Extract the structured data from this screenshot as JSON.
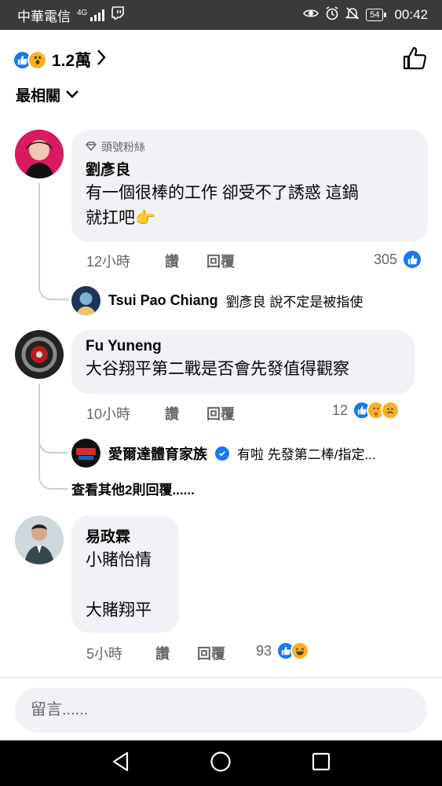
{
  "status_bar": {
    "carrier": "中華電信",
    "network": "4G",
    "battery": "54",
    "time": "00:42"
  },
  "reactions": {
    "total": "1.2萬",
    "types": [
      "like-icon",
      "wow-icon"
    ]
  },
  "sort": {
    "label": "最相關"
  },
  "comments": [
    {
      "badge": "頭號粉絲",
      "author": "劉彥良",
      "text_line1": "有一個很棒的工作 卻受不了誘惑 這鍋",
      "text_line2": "就扛吧👉",
      "time": "12小時",
      "like_label": "讚",
      "reply_label": "回覆",
      "reaction_count": "305",
      "reply": {
        "author": "Tsui Pao Chiang",
        "text": "劉彥良 說不定是被指使"
      }
    },
    {
      "author": "Fu Yuneng",
      "text": "大谷翔平第二戰是否會先發值得觀察",
      "time": "10小時",
      "like_label": "讚",
      "reply_label": "回覆",
      "reaction_count": "12",
      "reply": {
        "author": "愛爾達體育家族",
        "text": "有啦 先發第二棒/指定..."
      },
      "more_replies": "查看其他2則回覆......"
    },
    {
      "author": "易政霖",
      "text_line1": "小賭怡情",
      "text_line2": "大賭翔平",
      "time": "5小時",
      "like_label": "讚",
      "reply_label": "回覆",
      "reaction_count": "93"
    }
  ],
  "composer": {
    "placeholder": "留言......"
  },
  "colors": {
    "accent": "#1877f2",
    "bubble": "#f0f2f5",
    "meta": "#65676b"
  }
}
